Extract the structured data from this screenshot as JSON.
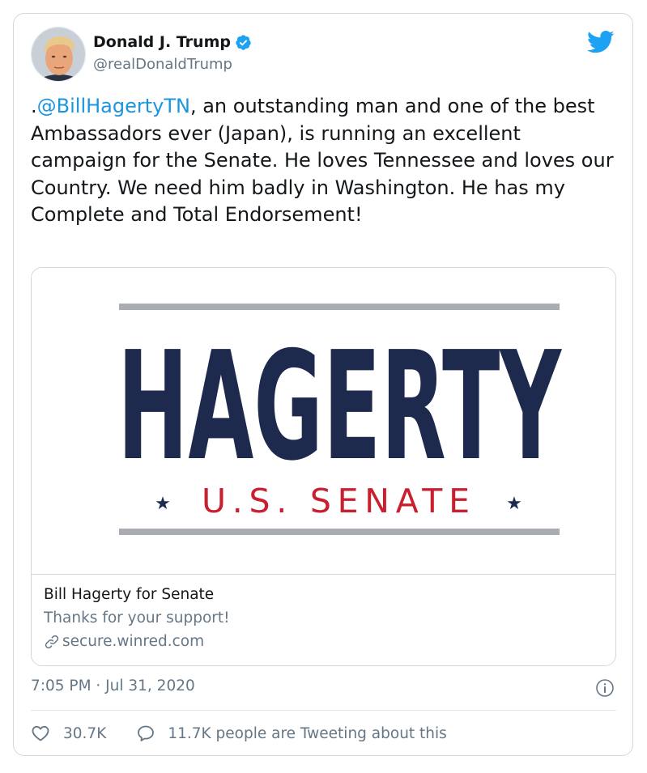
{
  "author": {
    "name": "Donald J. Trump",
    "handle": "@realDonaldTrump"
  },
  "tweet": {
    "mention": "@BillHagertyTN",
    "text_prefix": ".",
    "text_rest": ", an outstanding man and one of the best Ambassadors ever (Japan), is running an excellent campaign for the Senate. He loves Tennessee and loves our Country. We need him badly in Washington. He has my Complete and Total Endorsement!"
  },
  "card": {
    "logo_word": "HAGERTY",
    "logo_subtitle": "U.S. SENATE",
    "title": "Bill Hagerty for Senate",
    "description": "Thanks for your support!",
    "domain": "secure.winred.com"
  },
  "meta": {
    "timestamp": "7:05 PM · Jul 31, 2020"
  },
  "stats": {
    "likes": "30.7K",
    "tweeting": "11.7K people are Tweeting about this"
  },
  "colors": {
    "mention": "#1b95e0",
    "navy": "#1d2a4d",
    "red": "#c8202f",
    "gray_bar": "#a9adb3",
    "twitter_blue": "#1da1f2"
  }
}
